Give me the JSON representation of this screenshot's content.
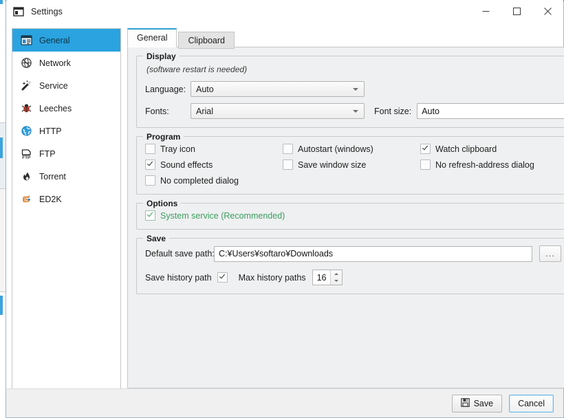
{
  "window": {
    "title": "Settings",
    "icon": "settings-window-icon",
    "controls": {
      "minimize": "—",
      "maximize": "☐",
      "close": "✕"
    }
  },
  "sidebar": {
    "items": [
      {
        "label": "General",
        "icon": "general-icon",
        "selected": true
      },
      {
        "label": "Network",
        "icon": "network-icon",
        "selected": false
      },
      {
        "label": "Service",
        "icon": "service-icon",
        "selected": false
      },
      {
        "label": "Leeches",
        "icon": "leeches-icon",
        "selected": false
      },
      {
        "label": "HTTP",
        "icon": "http-icon",
        "selected": false
      },
      {
        "label": "FTP",
        "icon": "ftp-icon",
        "selected": false
      },
      {
        "label": "Torrent",
        "icon": "torrent-icon",
        "selected": false
      },
      {
        "label": "ED2K",
        "icon": "ed2k-icon",
        "selected": false
      }
    ]
  },
  "tabs": [
    {
      "label": "General",
      "active": true
    },
    {
      "label": "Clipboard",
      "active": false
    }
  ],
  "display": {
    "legend": "Display",
    "note": "(software restart is needed)",
    "language_label": "Language:",
    "language_value": "Auto",
    "fonts_label": "Fonts:",
    "fonts_value": "Arial",
    "font_size_label": "Font size:",
    "font_size_value": "Auto"
  },
  "program": {
    "legend": "Program",
    "checkboxes": [
      {
        "label": "Tray icon",
        "checked": false
      },
      {
        "label": "Autostart (windows)",
        "checked": false
      },
      {
        "label": "Watch clipboard",
        "checked": true
      },
      {
        "label": "Sound effects",
        "checked": true
      },
      {
        "label": "Save window size",
        "checked": false
      },
      {
        "label": "No refresh-address dialog",
        "checked": false
      },
      {
        "label": "No completed dialog",
        "checked": false
      }
    ]
  },
  "options": {
    "legend": "Options",
    "system_service_label": "System service (Recommended)",
    "system_service_checked": true,
    "green": "#3a9e5f"
  },
  "save": {
    "legend": "Save",
    "path_label": "Default save path:",
    "path_value": "C:¥Users¥softaro¥Downloads",
    "browse_label": "...",
    "history_label": "Save history path",
    "history_checked": true,
    "max_history_label": "Max history paths",
    "max_history_value": "16"
  },
  "footer": {
    "save_label": "Save",
    "cancel_label": "Cancel"
  },
  "colors": {
    "accent": "#2aa3e0",
    "panel": "#eff0f1",
    "tab_active": "#2f9fd8"
  }
}
